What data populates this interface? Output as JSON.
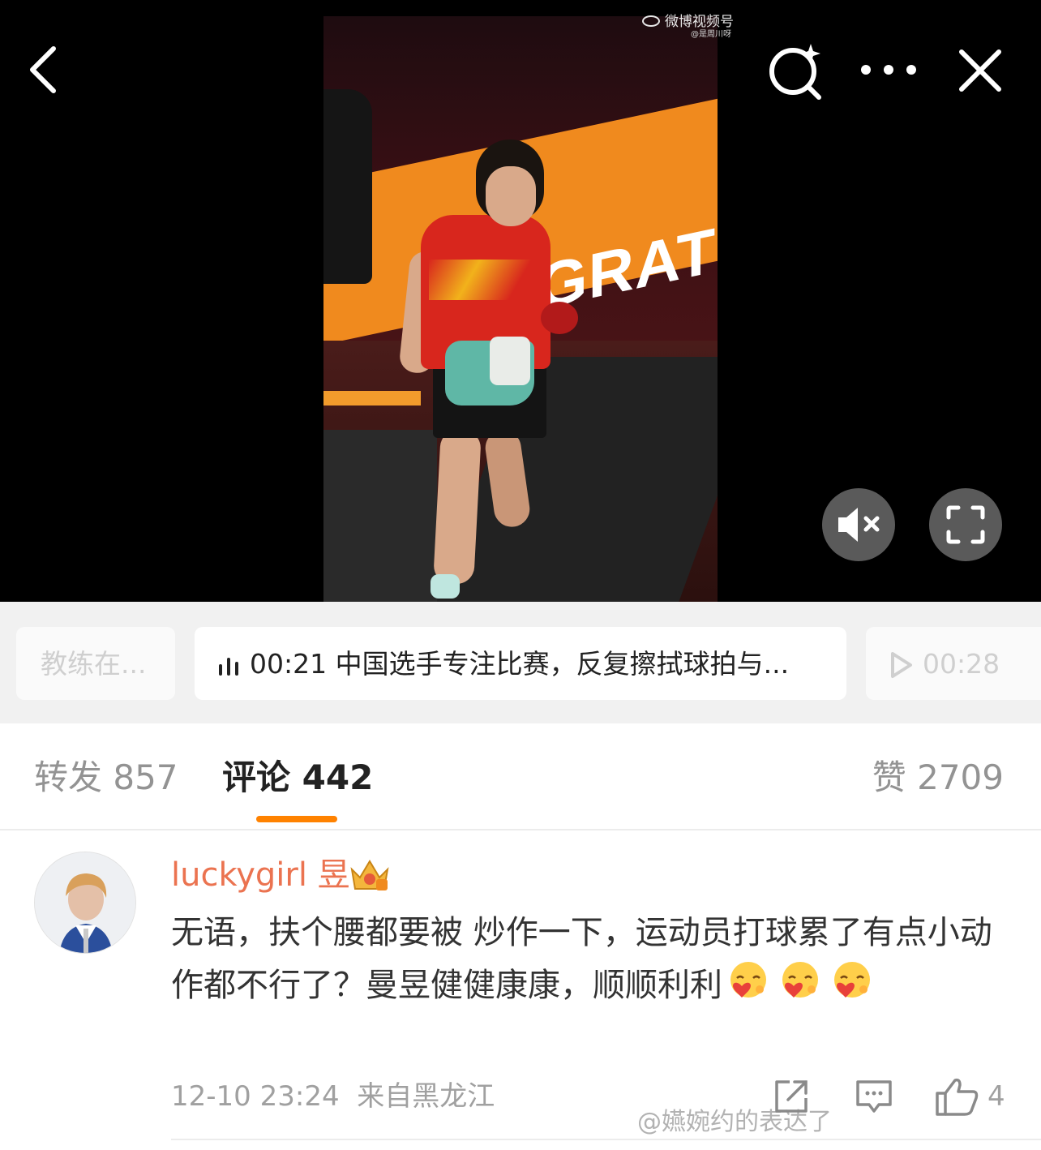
{
  "video": {
    "watermark": "微博视频号",
    "watermark_sub": "@是周川呀",
    "banner_text": "GRATU"
  },
  "chapters": {
    "previous": "教练在...",
    "active": "00:21 中国选手专注比赛，反复擦拭球拍与...",
    "next": "00:28"
  },
  "tabs": {
    "repost": "转发 857",
    "comment": "评论 442",
    "like": "赞 2709"
  },
  "comment": {
    "username": "luckygirl 昱",
    "text": "无语，扶个腰都要被 炒作一下，运动员打球累了有点小动作都不行了？曼昱健健康康，顺顺利利",
    "time": "12-10 23:24",
    "location": "来自黑龙江",
    "like_count": "4",
    "emoji_name": "hug-heart-emoji"
  },
  "credit": "@嬿婉约的表达了",
  "colors": {
    "accent": "#ff8200",
    "username": "#eb7350",
    "banner": "#f08a1e"
  }
}
